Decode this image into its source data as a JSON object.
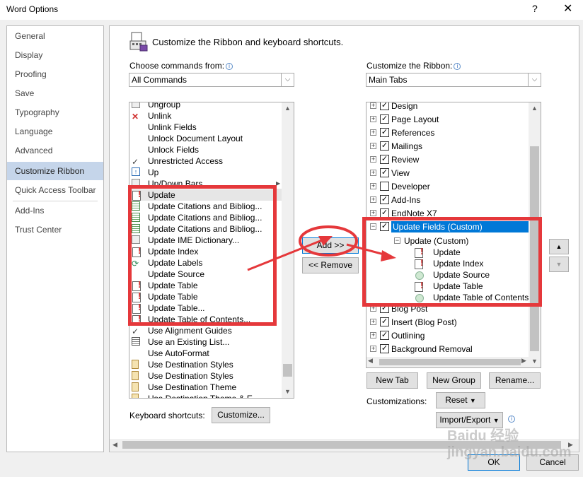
{
  "window": {
    "title": "Word Options",
    "help_glyph": "?",
    "close_glyph": "✕"
  },
  "nav": {
    "items": [
      {
        "label": "General"
      },
      {
        "label": "Display"
      },
      {
        "label": "Proofing"
      },
      {
        "label": "Save"
      },
      {
        "label": "Typography"
      },
      {
        "label": "Language"
      },
      {
        "label": "Advanced"
      },
      {
        "label": "Customize Ribbon"
      },
      {
        "label": "Quick Access Toolbar"
      },
      {
        "label": "Add-Ins"
      },
      {
        "label": "Trust Center"
      }
    ],
    "selected": "Customize Ribbon"
  },
  "header": {
    "text": "Customize the Ribbon and keyboard shortcuts."
  },
  "left": {
    "choose_label": "Choose commands from:",
    "choose_value": "All Commands",
    "commands": [
      {
        "label": "Ungroup",
        "icon": "ungroup-icon"
      },
      {
        "label": "Unlink",
        "icon": "unlink-icon"
      },
      {
        "label": "Unlink Fields",
        "icon": ""
      },
      {
        "label": "Unlock Document Layout",
        "icon": ""
      },
      {
        "label": "Unlock Fields",
        "icon": ""
      },
      {
        "label": "Unrestricted Access",
        "icon": "check-icon"
      },
      {
        "label": "Up",
        "icon": "up-arrow-icon"
      },
      {
        "label": "Up/Down Bars",
        "icon": "bars-icon"
      },
      {
        "label": "Update",
        "icon": "update-doc-icon"
      },
      {
        "label": "Update Citations and Bibliog...",
        "icon": "citation-icon"
      },
      {
        "label": "Update Citations and Bibliog...",
        "icon": "citation-icon"
      },
      {
        "label": "Update Citations and Bibliog...",
        "icon": "citation-icon"
      },
      {
        "label": "Update IME Dictionary...",
        "icon": "ime-icon"
      },
      {
        "label": "Update Index",
        "icon": "update-doc-icon"
      },
      {
        "label": "Update Labels",
        "icon": "refresh-icon"
      },
      {
        "label": "Update Source",
        "icon": ""
      },
      {
        "label": "Update Table",
        "icon": "update-doc-icon"
      },
      {
        "label": "Update Table",
        "icon": "update-doc-icon"
      },
      {
        "label": "Update Table...",
        "icon": "update-doc-icon"
      },
      {
        "label": "Update Table of Contents...",
        "icon": "update-doc-icon"
      },
      {
        "label": "Use Alignment Guides",
        "icon": "check-icon"
      },
      {
        "label": "Use an Existing List...",
        "icon": "list-icon"
      },
      {
        "label": "Use AutoFormat",
        "icon": ""
      },
      {
        "label": "Use Destination Styles",
        "icon": "paste-icon"
      },
      {
        "label": "Use Destination Styles",
        "icon": "paste-icon"
      },
      {
        "label": "Use Destination Theme",
        "icon": "paste-icon"
      },
      {
        "label": "Use Destination Theme & E...",
        "icon": "paste-icon"
      }
    ],
    "keyboard_label": "Keyboard shortcuts:",
    "customize_btn": "Customize..."
  },
  "middle": {
    "add_btn": "Add >>",
    "remove_btn": "<< Remove"
  },
  "right": {
    "customize_label": "Customize the Ribbon:",
    "ribbon_value": "Main Tabs",
    "tree": [
      {
        "label": "Design",
        "level": 0,
        "checked": true,
        "expander": "+"
      },
      {
        "label": "Page Layout",
        "level": 0,
        "checked": true,
        "expander": "+"
      },
      {
        "label": "References",
        "level": 0,
        "checked": true,
        "expander": "+"
      },
      {
        "label": "Mailings",
        "level": 0,
        "checked": true,
        "expander": "+"
      },
      {
        "label": "Review",
        "level": 0,
        "checked": true,
        "expander": "+"
      },
      {
        "label": "View",
        "level": 0,
        "checked": true,
        "expander": "+"
      },
      {
        "label": "Developer",
        "level": 0,
        "checked": false,
        "expander": "+"
      },
      {
        "label": "Add-Ins",
        "level": 0,
        "checked": true,
        "expander": "+"
      },
      {
        "label": "EndNote X7",
        "level": 0,
        "checked": true,
        "expander": "+"
      },
      {
        "label": "Update Fields (Custom)",
        "level": 0,
        "checked": true,
        "expander": "−",
        "selected": true
      },
      {
        "label": "Update (Custom)",
        "level": 1,
        "expander": "−"
      },
      {
        "label": "Update",
        "level": 2,
        "icon": "update-doc-icon"
      },
      {
        "label": "Update Index",
        "level": 2,
        "icon": "update-doc-icon"
      },
      {
        "label": "Update Source",
        "level": 2,
        "icon": "circle-icon"
      },
      {
        "label": "Update Table",
        "level": 2,
        "icon": "update-doc-icon"
      },
      {
        "label": "Update Table of Contents",
        "level": 2,
        "icon": "circle-icon"
      },
      {
        "label": "Blog Post",
        "level": 0,
        "checked": true,
        "expander": "+"
      },
      {
        "label": "Insert (Blog Post)",
        "level": 0,
        "checked": true,
        "expander": "+"
      },
      {
        "label": "Outlining",
        "level": 0,
        "checked": true,
        "expander": "+"
      },
      {
        "label": "Background Removal",
        "level": 0,
        "checked": true,
        "expander": "+"
      }
    ],
    "new_tab_btn": "New Tab",
    "new_group_btn": "New Group",
    "rename_btn": "Rename...",
    "customizations_label": "Customizations:",
    "reset_btn": "Reset",
    "import_export_btn": "Import/Export"
  },
  "footer": {
    "ok_btn": "OK",
    "cancel_btn": "Cancel"
  },
  "watermark": "Baidu 经验 jingyan.baidu.com",
  "colors": {
    "accent": "#0078d7",
    "selection": "#c5d5ea",
    "highlight_red": "#e5383b"
  }
}
